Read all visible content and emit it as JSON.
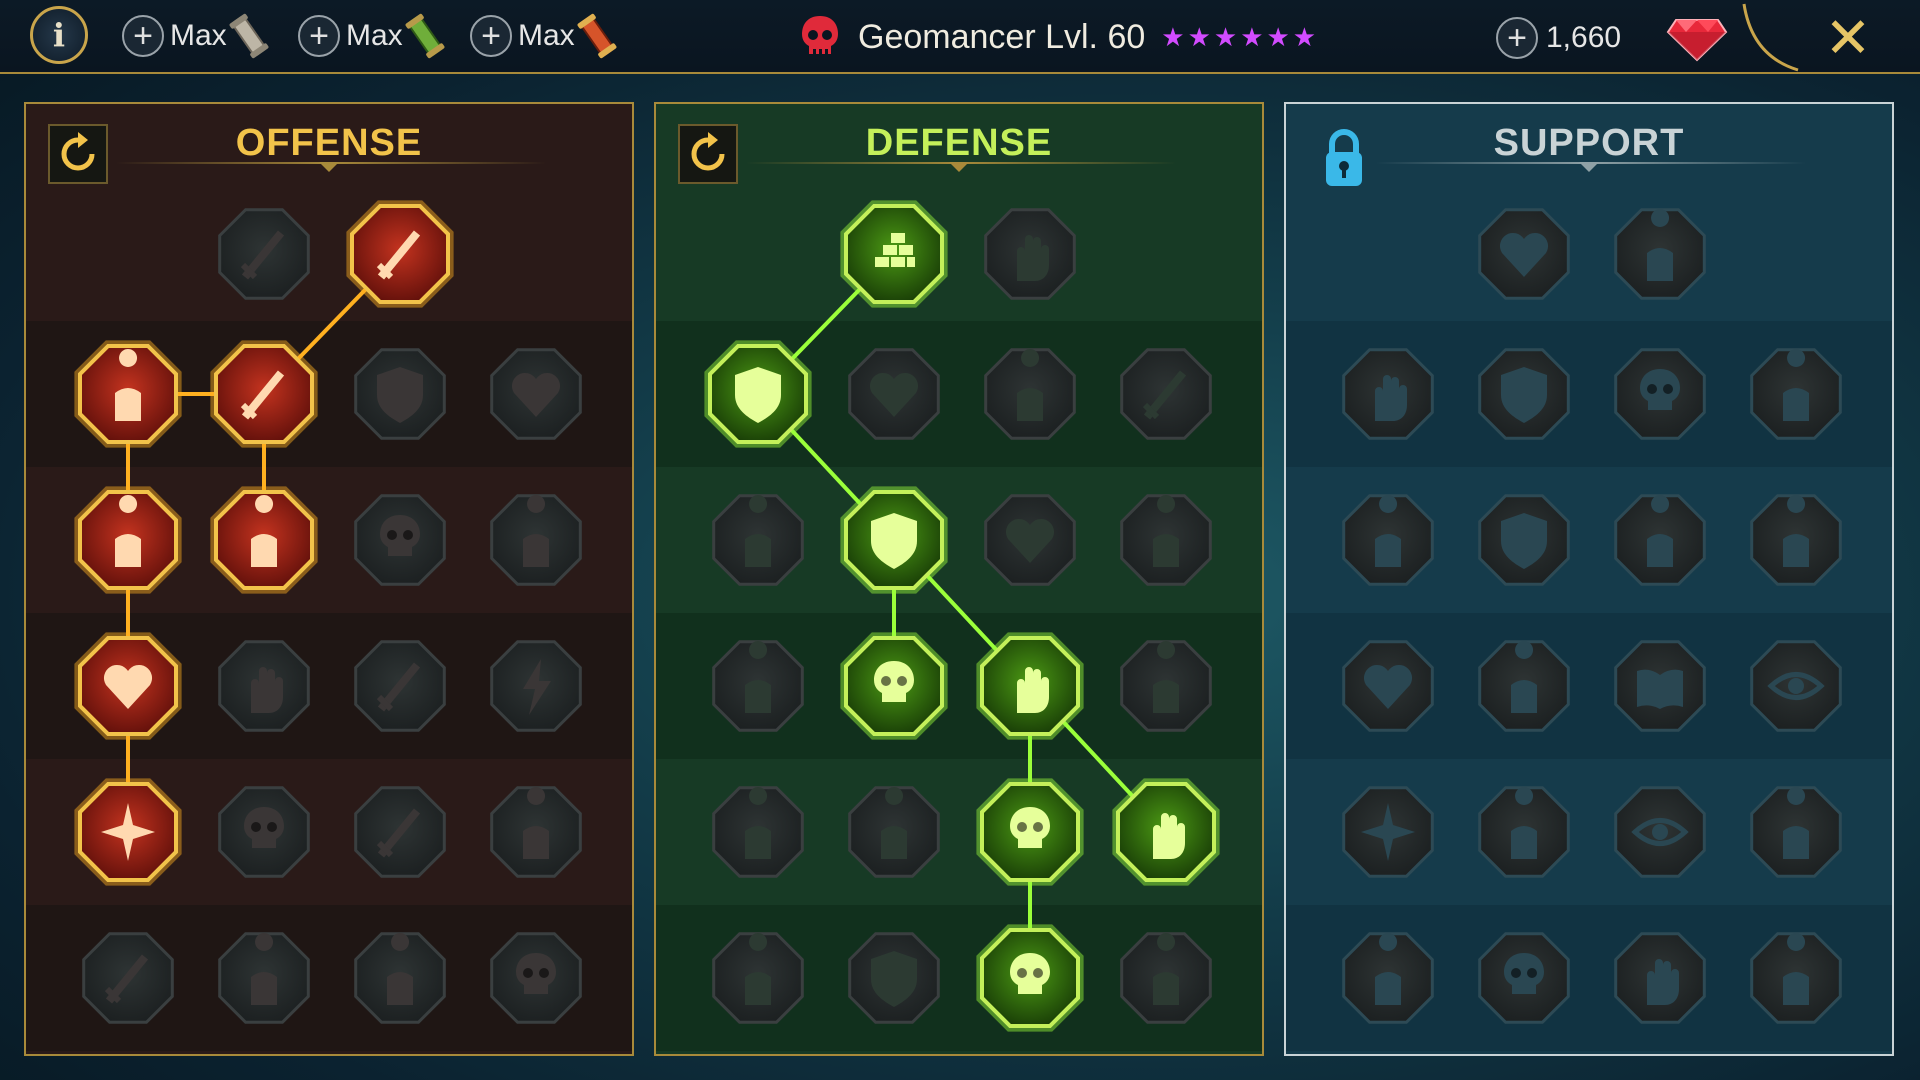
{
  "topbar": {
    "info_label": "i",
    "resources": [
      {
        "label": "Max",
        "icon": "scroll-gray-icon",
        "color": "#b8b0a0"
      },
      {
        "label": "Max",
        "icon": "scroll-green-icon",
        "color": "#6fae3a"
      },
      {
        "label": "Max",
        "icon": "scroll-red-icon",
        "color": "#d6542a"
      }
    ],
    "champion_title": "Geomancer Lvl. 60",
    "stars": "★★★★★★",
    "gems": "1,660",
    "close_label": "✕"
  },
  "panels": [
    {
      "id": "offense",
      "title": "OFFENSE",
      "theme": {
        "accent": "#f2c34a",
        "glow": "#ffb020",
        "fill1": "#c4331f",
        "fill2": "#5e0f0a",
        "bg": "#2a1a18",
        "stripe": "#1f1614"
      },
      "locked": false,
      "rows": [
        [
          {
            "icon": "crossed-swords-icon",
            "active": false
          },
          {
            "icon": "flaming-blade-icon",
            "active": true
          }
        ],
        [
          {
            "icon": "horned-demon-icon",
            "active": true
          },
          {
            "icon": "feathered-spear-icon",
            "active": true
          },
          {
            "icon": "shield-arrow-icon",
            "active": false
          },
          {
            "icon": "broken-heart-icon",
            "active": false
          }
        ],
        [
          {
            "icon": "pierced-warrior-icon",
            "active": true
          },
          {
            "icon": "fanged-maw-icon",
            "active": true
          },
          {
            "icon": "skull-cloak-icon",
            "active": false
          },
          {
            "icon": "claw-slash-icon",
            "active": false
          }
        ],
        [
          {
            "icon": "bleeding-heart-sword-icon",
            "active": true
          },
          {
            "icon": "fist-strike-icon",
            "active": false
          },
          {
            "icon": "axe-icon",
            "active": false
          },
          {
            "icon": "chain-lightning-icon",
            "active": false
          }
        ],
        [
          {
            "icon": "arrow-burst-icon",
            "active": true
          },
          {
            "icon": "twin-skulls-icon",
            "active": false
          },
          {
            "icon": "dagger-circle-icon",
            "active": false
          },
          {
            "icon": "raging-figure-icon",
            "active": false
          }
        ],
        [
          {
            "icon": "sparkle-sword-icon",
            "active": false
          },
          {
            "icon": "knight-helm-icon",
            "active": false
          },
          {
            "icon": "horned-beast-icon",
            "active": false
          },
          {
            "icon": "skull-burst-icon",
            "active": false
          }
        ]
      ]
    },
    {
      "id": "defense",
      "title": "DEFENSE",
      "theme": {
        "accent": "#c4f05a",
        "glow": "#9bff3a",
        "fill1": "#4c9a14",
        "fill2": "#173a06",
        "bg": "#173a25",
        "stripe": "#11301d"
      },
      "locked": false,
      "rows": [
        [
          {
            "icon": "stone-bricks-icon",
            "active": true
          },
          {
            "icon": "raised-fist-icon",
            "active": false
          }
        ],
        [
          {
            "icon": "layered-shield-icon",
            "active": true
          },
          {
            "icon": "heart-vial-icon",
            "active": false
          },
          {
            "icon": "armored-brute-icon",
            "active": false
          },
          {
            "icon": "deflect-blades-icon",
            "active": false
          }
        ],
        [
          {
            "icon": "runner-icon",
            "active": false
          },
          {
            "icon": "knight-shield-icon",
            "active": true
          },
          {
            "icon": "heart-icon",
            "active": false
          },
          {
            "icon": "aura-head-icon",
            "active": false
          }
        ],
        [
          {
            "icon": "crowd-icon",
            "active": false
          },
          {
            "icon": "hourglass-skull-icon",
            "active": true
          },
          {
            "icon": "open-hand-icon",
            "active": true
          },
          {
            "icon": "bull-head-icon",
            "active": false
          }
        ],
        [
          {
            "icon": "dash-figure-icon",
            "active": false
          },
          {
            "icon": "triple-drops-icon",
            "active": false
          },
          {
            "icon": "sun-skull-icon",
            "active": true
          },
          {
            "icon": "grasping-hand-icon",
            "active": true
          }
        ],
        [
          {
            "icon": "spiky-warrior-icon",
            "active": false
          },
          {
            "icon": "winged-shield-icon",
            "active": false
          },
          {
            "icon": "radiant-skull-icon",
            "active": true
          },
          {
            "icon": "muscle-figure-icon",
            "active": false
          }
        ]
      ]
    },
    {
      "id": "support",
      "title": "SUPPORT",
      "theme": {
        "accent": "#c9d3d6",
        "glow": "#7fdfff",
        "fill1": "#234450",
        "fill2": "#122a33",
        "bg": "#153b4b",
        "stripe": "#113342"
      },
      "locked": true,
      "rows": [
        [
          {
            "icon": "heart-plus-icon",
            "active": false
          },
          {
            "icon": "swirl-claw-icon",
            "active": false
          }
        ],
        [
          {
            "icon": "praying-hands-icon",
            "active": false
          },
          {
            "icon": "dome-shield-icon",
            "active": false
          },
          {
            "icon": "flaming-skull-icon",
            "active": false
          },
          {
            "icon": "boot-dash-icon",
            "active": false
          }
        ],
        [
          {
            "icon": "blessed-figure-icon",
            "active": false
          },
          {
            "icon": "lightning-shield-icon",
            "active": false
          },
          {
            "icon": "shatter-icon",
            "active": false
          },
          {
            "icon": "shadow-pair-icon",
            "active": false
          }
        ],
        [
          {
            "icon": "chained-heart-icon",
            "active": false
          },
          {
            "icon": "comet-icon",
            "active": false
          },
          {
            "icon": "open-book-icon",
            "active": false
          },
          {
            "icon": "angry-eyes-icon",
            "active": false
          }
        ],
        [
          {
            "icon": "compass-star-icon",
            "active": false
          },
          {
            "icon": "swift-boot-icon",
            "active": false
          },
          {
            "icon": "all-seeing-eye-icon",
            "active": false
          },
          {
            "icon": "voodoo-doll-icon",
            "active": false
          }
        ],
        [
          {
            "icon": "poison-flask-icon",
            "active": false
          },
          {
            "icon": "horned-skull-icon",
            "active": false
          },
          {
            "icon": "fist-crest-icon",
            "active": false
          },
          {
            "icon": "eagle-head-icon",
            "active": false
          }
        ]
      ]
    }
  ]
}
